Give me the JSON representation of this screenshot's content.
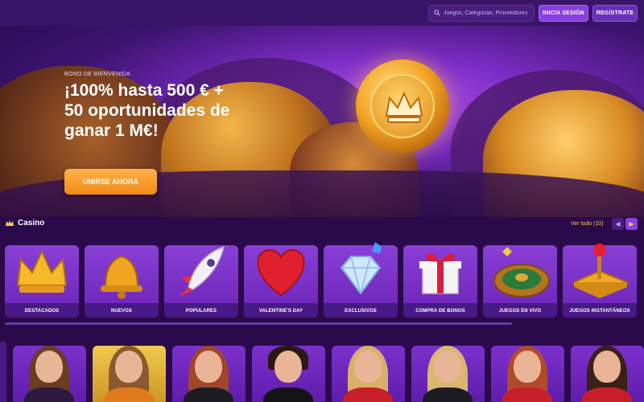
{
  "header": {
    "search_placeholder": "Juegos, Categorías, Proveedores",
    "login_label": "INICIA SESIÓN",
    "register_label": "REGÍSTRATE"
  },
  "hero": {
    "bonus_label": "BONO DE BIENVENIDA",
    "title": "¡100% hasta 500 € + 50 oportunidades de ganar 1 M€!",
    "cta_label": "UNIRSE AHORA"
  },
  "casino": {
    "title": "Casino",
    "see_all": "Ver todo (10)",
    "categories": [
      {
        "label": "DESTACADOS",
        "icon": "crown-icon"
      },
      {
        "label": "NUEVOS",
        "icon": "bell-icon"
      },
      {
        "label": "POPULARES",
        "icon": "rocket-icon"
      },
      {
        "label": "VALENTINE'S DAY",
        "icon": "heart-icon"
      },
      {
        "label": "EXCLUSIVOS",
        "icon": "diamond-icon"
      },
      {
        "label": "COMPRA DE BONOS",
        "icon": "gift-icon"
      },
      {
        "label": "JUEGOS EN VIVO",
        "icon": "roulette-icon"
      },
      {
        "label": "JUEGOS INSTANTÁNEOS",
        "icon": "joystick-icon"
      }
    ]
  },
  "colors": {
    "accent": "#8a3fe0",
    "cta": "#f28a14",
    "link": "#ffc94a",
    "background": "#2a0a4a"
  }
}
